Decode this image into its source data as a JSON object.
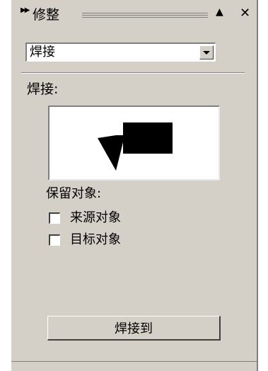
{
  "panel": {
    "title": "修整",
    "expand_icon": "chevron-double-right-icon",
    "collapse_icon": "triangle-up-icon",
    "close_icon": "close-icon"
  },
  "operation": {
    "selected": "焊接"
  },
  "section": {
    "label": "焊接:"
  },
  "keep_objects": {
    "label": "保留对象:",
    "options": [
      {
        "label": "来源对象",
        "checked": false
      },
      {
        "label": "目标对象",
        "checked": false
      }
    ]
  },
  "action": {
    "label": "焊接到"
  },
  "colors": {
    "panel_bg": "#d4d0c8",
    "preview_shape": "#000000"
  }
}
